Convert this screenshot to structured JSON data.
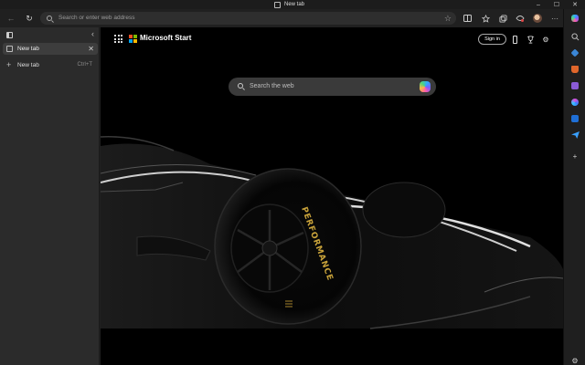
{
  "window": {
    "title": "New tab"
  },
  "window_controls": {
    "minimize": "–",
    "maximize": "☐",
    "close": "✕"
  },
  "toolbar": {
    "back": "←",
    "refresh": "↻",
    "address_placeholder": "Search or enter web address",
    "favorite": "☆"
  },
  "sidebar": {
    "collapse": "‹",
    "tabs": [
      {
        "label": "New tab",
        "close": "✕"
      }
    ],
    "new_tab": {
      "plus": "+",
      "label": "New tab",
      "shortcut": "Ctrl+T"
    }
  },
  "newtab_page": {
    "brand": "Microsoft Start",
    "sign_in": "Sign in",
    "search_placeholder": "Search the web",
    "hero_tyre_text": "PERFORMANCE"
  },
  "edge_sidebar": {
    "add": "+",
    "settings": "⚙"
  },
  "colors": {
    "ms_red": "#f25022",
    "ms_green": "#7fba00",
    "ms_blue": "#00a4ef",
    "ms_yellow": "#ffb900",
    "tyre_text": "#c8a23a"
  }
}
